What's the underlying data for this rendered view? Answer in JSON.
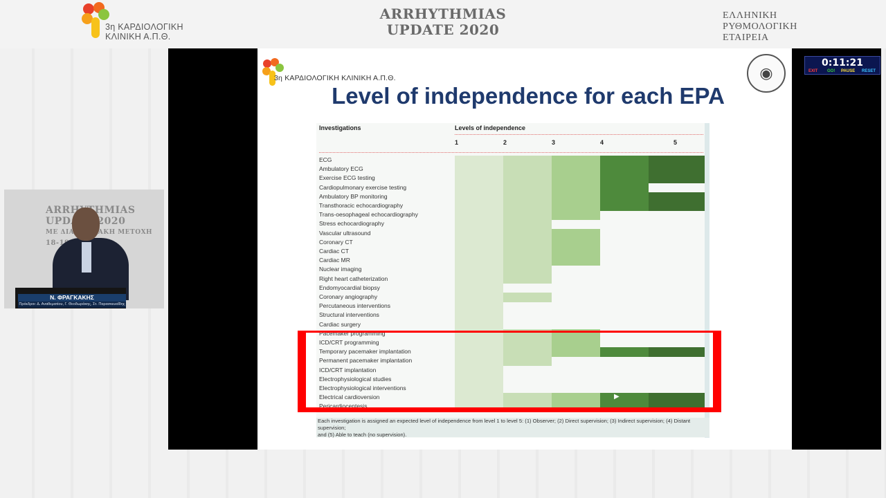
{
  "header": {
    "logo_line1": "3η ΚΑΡΔΙΟΛΟΓΙΚΗ",
    "logo_line2": "ΚΛΙΝΙΚΗ Α.Π.Θ.",
    "title_line1": "ARRHYTHMIAS",
    "title_line2": "UPDATE 2020",
    "society_line1": "ΕΛΛΗΝΙΚΗ",
    "society_line2": "ΡΥΘΜΟΛΟΓΙΚΗ",
    "society_line3": "ΕΤΑΙΡΕΙΑ"
  },
  "slide": {
    "logo_text": "3η ΚΑΡΔΙΟΛΟΓΙΚΗ ΚΛΙΝΙΚΗ Α.Π.Θ.",
    "title": "Level of independence for each EPA",
    "table": {
      "col_investigations": "Investigations",
      "col_levels": "Levels of independence",
      "level_numbers": [
        "1",
        "2",
        "3",
        "4",
        "5"
      ],
      "rows": [
        {
          "label": "ECG",
          "level": 5
        },
        {
          "label": "Ambulatory ECG",
          "level": 5
        },
        {
          "label": "Exercise ECG testing",
          "level": 5
        },
        {
          "label": "Cardiopulmonary exercise testing",
          "level": 4
        },
        {
          "label": "Ambulatory BP monitoring",
          "level": 5
        },
        {
          "label": "Transthoracic echocardiography",
          "level": 5
        },
        {
          "label": "Trans-oesophageal echocardiography",
          "level": 3
        },
        {
          "label": "Stress echocardiography",
          "level": 2
        },
        {
          "label": "Vascular ultrasound",
          "level": 3
        },
        {
          "label": "Coronary CT",
          "level": 3
        },
        {
          "label": "Cardiac CT",
          "level": 3
        },
        {
          "label": "Cardiac MR",
          "level": 3
        },
        {
          "label": "Nuclear imaging",
          "level": 2
        },
        {
          "label": "Right heart catheterization",
          "level": 2
        },
        {
          "label": "Endomyocardial biopsy",
          "level": 1
        },
        {
          "label": "Coronary angiography",
          "level": 2
        },
        {
          "label": "Percutaneous interventions",
          "level": 1
        },
        {
          "label": "Structural interventions",
          "level": 1
        },
        {
          "label": "Cardiac surgery",
          "level": 1
        },
        {
          "label": "Pacemaker programming",
          "level": 3
        },
        {
          "label": "ICD/CRT programming",
          "level": 3
        },
        {
          "label": "Temporary pacemaker implantation",
          "level": 5
        },
        {
          "label": "Permanent pacemaker implantation",
          "level": 2
        },
        {
          "label": "ICD/CRT implantation",
          "level": 1
        },
        {
          "label": "Electrophysiological studies",
          "level": 1
        },
        {
          "label": "Electrophysiological interventions",
          "level": 1
        },
        {
          "label": "Electrical cardioversion",
          "level": 5
        },
        {
          "label": "Pericardiocentesis",
          "level": 5
        }
      ],
      "footnote_line1": "Each investigation is assigned an expected level of independence from level 1 to level 5: (1) Observer; (2) Direct supervision; (3) Indirect supervision; (4) Distant supervision;",
      "footnote_line2": "and (5) Able to teach (no supervision)."
    },
    "colors": {
      "level1": "#dce9d1",
      "level2": "#c8deb6",
      "level3": "#a8cf8e",
      "level4": "#4e8a3c",
      "level5": "#3f6f30",
      "highlight": "#ff0000"
    }
  },
  "speaker": {
    "bg_line1": "ARRHYTHMIAS",
    "bg_line2": "UPDATE 2020",
    "bg_line3": "ΜΕ ΔΙΑΔΙΚΤΥΑΚΗ ΜΕΤΟΧΗ",
    "bg_line4": "18-19/09/2020",
    "name": "Ν. ΦΡΑΓΚΑΚΗΣ",
    "subtitle": "Πρόεδροι: Δ. Αναθεματίου, Γ. Θεοδωράκης, Στ. Παρασκευαΐδης"
  },
  "timer": {
    "time": "0:11:21",
    "buttons": {
      "exit": "EXIT",
      "go": "GO!",
      "pause": "PAUSE",
      "reset": "RESET"
    }
  }
}
